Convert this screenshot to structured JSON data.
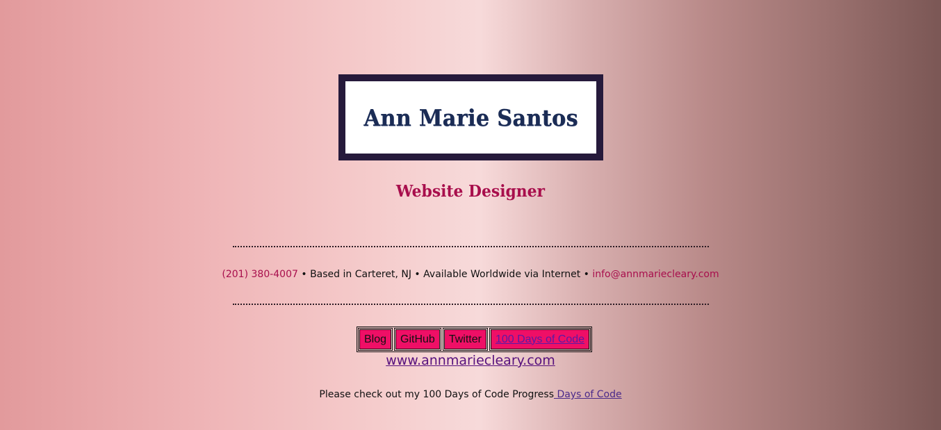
{
  "header": {
    "name": "Ann Marie Santos",
    "subtitle": "Website Designer"
  },
  "contact": {
    "phone": "(201) 380-4007",
    "sep1": " • ",
    "location": "Based in Carteret, NJ",
    "sep2": " • ",
    "availability": "Available Worldwide via Internet",
    "sep3": " • ",
    "email": "info@annmariecleary.com"
  },
  "nav": {
    "items": [
      {
        "label": "Blog"
      },
      {
        "label": "GitHub"
      },
      {
        "label": "Twitter"
      },
      {
        "label": "100 Days of Code"
      }
    ]
  },
  "site": {
    "url": "www.annmariecleary.com"
  },
  "progress": {
    "text": "Please check out my 100 Days of Code Progress",
    "link": " Days of Code"
  },
  "colors": {
    "accent": "#a80e4c",
    "nav_bg": "#ef0f66",
    "name_border": "#261a3b"
  }
}
